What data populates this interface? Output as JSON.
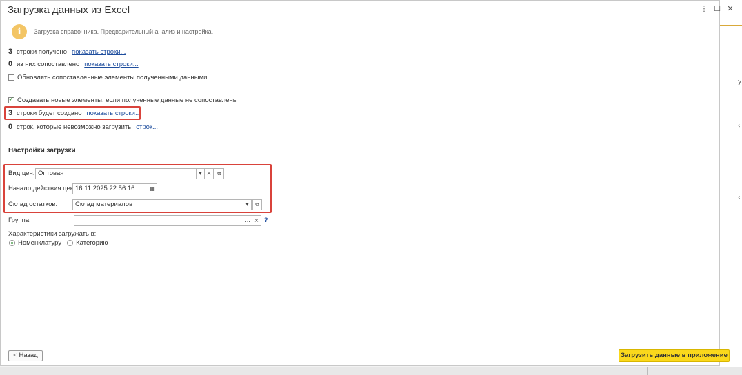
{
  "window": {
    "title": "Загрузка данных из Excel"
  },
  "window_controls": {
    "more": "⋮",
    "maximize": "☐",
    "close": "✕"
  },
  "info": {
    "text": "Загрузка справочника. Предварительный анализ и настройка."
  },
  "stats": {
    "received": {
      "count": "3",
      "label": "строки получено",
      "link": "показать строки..."
    },
    "matched": {
      "count": "0",
      "label": "из них сопоставлено",
      "link": "показать строки..."
    },
    "update_checkbox": {
      "checked": false,
      "label": "Обновлять сопоставленные элементы полученными данными"
    },
    "create_checkbox": {
      "checked": true,
      "label": "Создавать новые элементы, если полученные данные не сопоставлены"
    },
    "to_create": {
      "count": "3",
      "label": "строки будет создано",
      "link": "показать строки..."
    },
    "failed": {
      "count": "0",
      "label": "строк, которые невозможно загрузить",
      "link": "строк..."
    }
  },
  "settings": {
    "section_title": "Настройки загрузки",
    "price_type": {
      "label": "Вид цен:",
      "value": "Оптовая"
    },
    "price_start": {
      "label": "Начало действия цен:",
      "value": "16.11.2025 22:56:16"
    },
    "warehouse": {
      "label": "Склад остатков:",
      "value": "Склад материалов"
    },
    "group": {
      "label": "Группа:",
      "value": "",
      "help": "?"
    },
    "characteristics": {
      "label": "Характеристики загружать в:",
      "options": [
        "Номенклатуру",
        "Категорию"
      ],
      "selected": "Номенклатуру"
    }
  },
  "buttons": {
    "back": "< Назад",
    "load": "Загрузить данные в приложение"
  },
  "colors": {
    "accent": "#fad81c",
    "highlight": "#d9433b",
    "link": "#1f4e9e",
    "check": "#2a8c2a"
  },
  "icons": {
    "info": "i",
    "dropdown": "▾",
    "clear": "×",
    "open": "⧉",
    "calendar": "▦",
    "ellipsis": "..."
  }
}
